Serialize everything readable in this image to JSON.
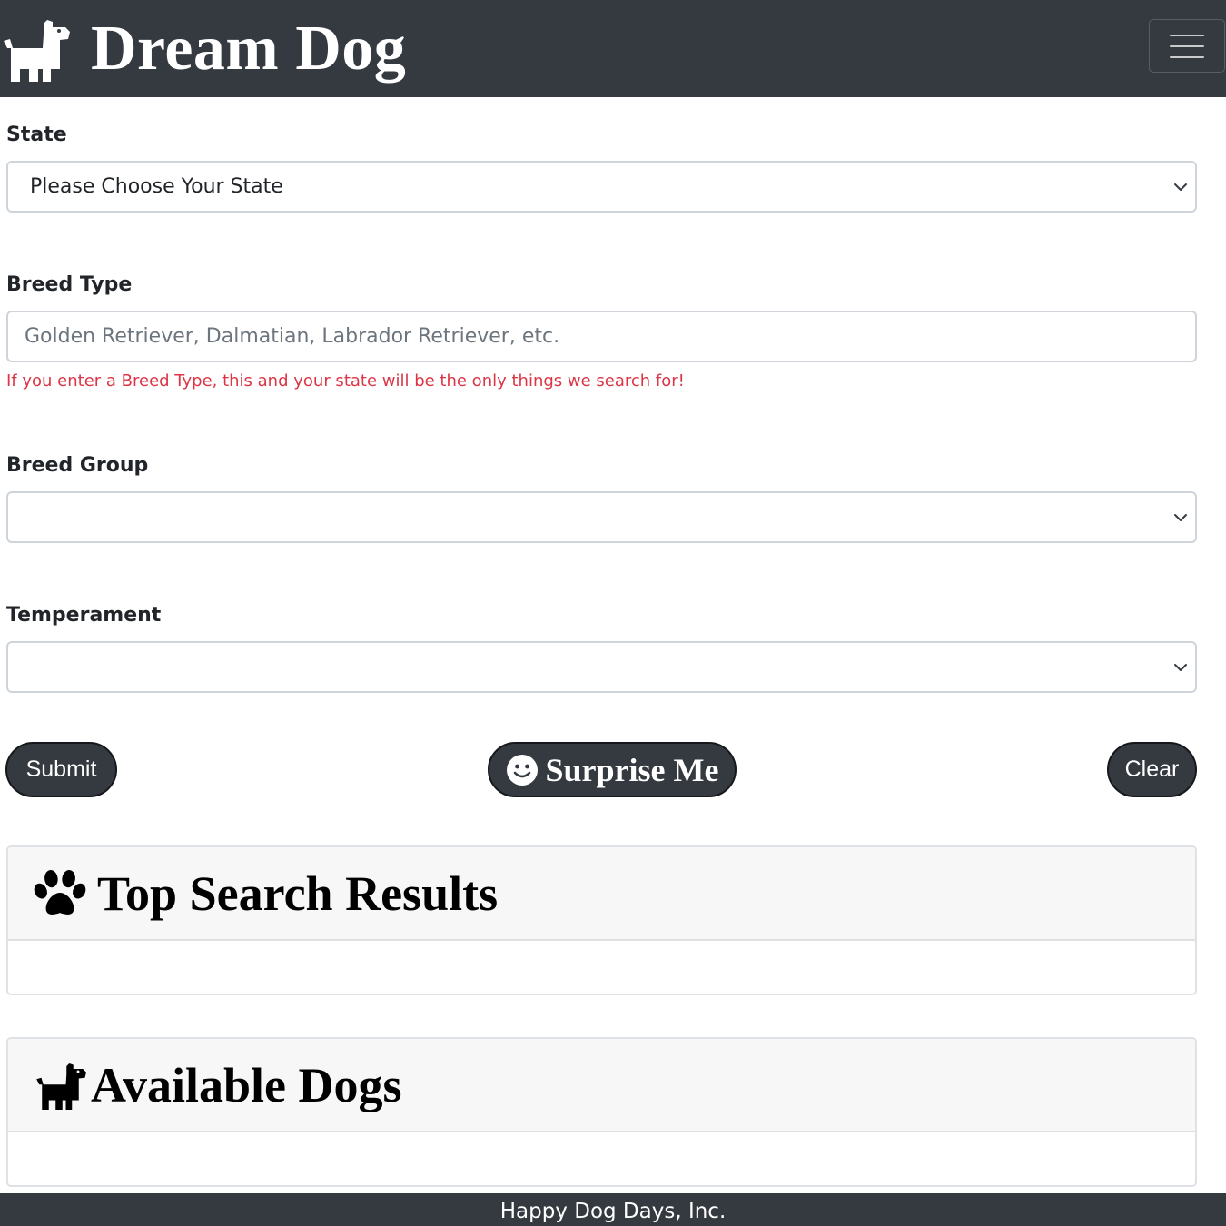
{
  "brand": {
    "title": "Dream Dog",
    "icon": "dog-icon"
  },
  "navbar": {
    "toggler_icon": "hamburger-menu-icon"
  },
  "form": {
    "state": {
      "label": "State",
      "selected": "Please Choose Your State"
    },
    "breed_type": {
      "label": "Breed Type",
      "placeholder": "Golden Retriever, Dalmatian, Labrador Retriever, etc.",
      "value": "",
      "help": "If you enter a Breed Type, this and your state will be the only things we search for!"
    },
    "breed_group": {
      "label": "Breed Group",
      "selected": ""
    },
    "temperament": {
      "label": "Temperament",
      "selected": ""
    }
  },
  "buttons": {
    "submit": "Submit",
    "surprise": "Surprise Me",
    "clear": "Clear"
  },
  "sections": {
    "top_results": {
      "title": "Top Search Results",
      "icon": "paw-icon"
    },
    "available_dogs": {
      "title": "Available Dogs",
      "icon": "dog-icon"
    }
  },
  "footer": {
    "text": "Happy Dog Days, Inc."
  },
  "colors": {
    "navbar": "#343a40",
    "button": "#343a40",
    "help_text": "#dc3545",
    "card_header": "#f7f7f7"
  }
}
